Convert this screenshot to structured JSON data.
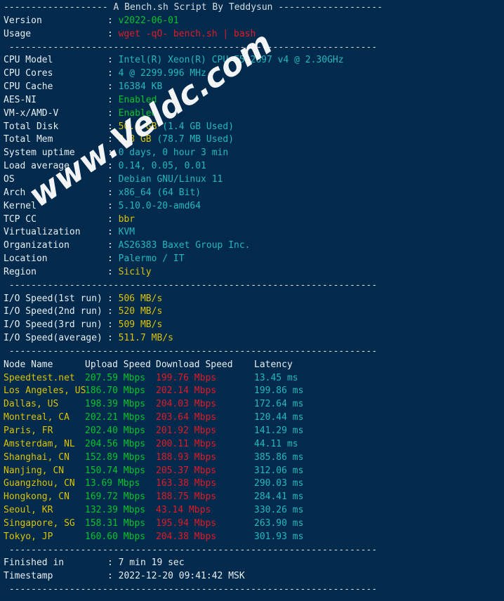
{
  "terminal": {
    "title_line": "------------------- A Bench.sh Script By Teddysun -------------------",
    "separator": " -------------------------------------------------------------------",
    "header": {
      "version_label": "Version",
      "version_value": "v2022-06-01",
      "usage_label": "Usage",
      "usage_value": "wget -qO- bench.sh | bash"
    },
    "sysinfo": [
      {
        "label": "CPU Model",
        "value": "Intel(R) Xeon(R) CPU E5-2697 v4 @ 2.30GHz",
        "color": "cyan"
      },
      {
        "label": "CPU Cores",
        "value": "4 @ 2299.996 MHz",
        "color": "cyan"
      },
      {
        "label": "CPU Cache",
        "value": "16384 KB",
        "color": "cyan"
      },
      {
        "label": "AES-NI",
        "value": "Enabled",
        "color": "green"
      },
      {
        "label": "VM-x/AMD-V",
        "value": "Enabled",
        "color": "green"
      },
      {
        "label": "Total Disk",
        "value": "50.1 GB",
        "value2": " (1.4 GB Used)",
        "color": "yellow",
        "color2": "cyan"
      },
      {
        "label": "Total Mem",
        "value": "3.8 GB",
        "value2": " (78.7 MB Used)",
        "color": "yellow",
        "color2": "cyan"
      },
      {
        "label": "System uptime",
        "value": "0 days, 0 hour 3 min",
        "color": "cyan"
      },
      {
        "label": "Load average",
        "value": "0.14, 0.05, 0.01",
        "color": "cyan"
      },
      {
        "label": "OS",
        "value": "Debian GNU/Linux 11",
        "color": "cyan"
      },
      {
        "label": "Arch",
        "value": "x86_64 (64 Bit)",
        "color": "cyan"
      },
      {
        "label": "Kernel",
        "value": "5.10.0-20-amd64",
        "color": "cyan"
      },
      {
        "label": "TCP CC",
        "value": "bbr",
        "color": "yellow"
      },
      {
        "label": "Virtualization",
        "value": "KVM",
        "color": "cyan"
      },
      {
        "label": "Organization",
        "value": "AS26383 Baxet Group Inc.",
        "color": "cyan"
      },
      {
        "label": "Location",
        "value": "Palermo / IT",
        "color": "cyan"
      },
      {
        "label": "Region",
        "value": "Sicily",
        "color": "yellow"
      }
    ],
    "io_speeds": [
      {
        "label": "I/O Speed(1st run)",
        "value": "506 MB/s"
      },
      {
        "label": "I/O Speed(2nd run)",
        "value": "520 MB/s"
      },
      {
        "label": "I/O Speed(3rd run)",
        "value": "509 MB/s"
      },
      {
        "label": "I/O Speed(average)",
        "value": "511.7 MB/s"
      }
    ],
    "speedtest": {
      "columns": [
        "Node Name",
        "Upload Speed",
        "Download Speed",
        "Latency"
      ],
      "rows": [
        {
          "node": "Speedtest.net",
          "upload": "207.59 Mbps",
          "download": "199.76 Mbps",
          "latency": "13.45 ms"
        },
        {
          "node": "Los Angeles, US",
          "upload": "186.70 Mbps",
          "download": "202.14 Mbps",
          "latency": "199.86 ms"
        },
        {
          "node": "Dallas, US",
          "upload": "198.39 Mbps",
          "download": "204.03 Mbps",
          "latency": "172.64 ms"
        },
        {
          "node": "Montreal, CA",
          "upload": "202.21 Mbps",
          "download": "203.64 Mbps",
          "latency": "120.44 ms"
        },
        {
          "node": "Paris, FR",
          "upload": "202.40 Mbps",
          "download": "201.92 Mbps",
          "latency": "141.29 ms"
        },
        {
          "node": "Amsterdam, NL",
          "upload": "204.56 Mbps",
          "download": "200.11 Mbps",
          "latency": "44.11 ms"
        },
        {
          "node": "Shanghai, CN",
          "upload": "152.89 Mbps",
          "download": "188.93 Mbps",
          "latency": "385.86 ms"
        },
        {
          "node": "Nanjing, CN",
          "upload": "150.74 Mbps",
          "download": "205.37 Mbps",
          "latency": "312.06 ms"
        },
        {
          "node": "Guangzhou, CN",
          "upload": "13.69 Mbps",
          "download": "163.38 Mbps",
          "latency": "290.03 ms"
        },
        {
          "node": "Hongkong, CN",
          "upload": "169.72 Mbps",
          "download": "188.75 Mbps",
          "latency": "284.41 ms"
        },
        {
          "node": "Seoul, KR",
          "upload": "132.39 Mbps",
          "download": "43.14 Mbps",
          "latency": "330.26 ms"
        },
        {
          "node": "Singapore, SG",
          "upload": "158.31 Mbps",
          "download": "195.94 Mbps",
          "latency": "263.90 ms"
        },
        {
          "node": "Tokyo, JP",
          "upload": "160.60 Mbps",
          "download": "204.38 Mbps",
          "latency": "301.93 ms"
        }
      ]
    },
    "footer": {
      "finished_label": "Finished in",
      "finished_value": "7 min 19 sec",
      "timestamp_label": "Timestamp",
      "timestamp_value": "2022-12-20 09:41:42 MSK"
    },
    "watermark": "www.Veldc.com"
  },
  "colors": {
    "background": "#012a4d",
    "white": "#e9eef2",
    "green": "#00c62a",
    "red": "#e21b26",
    "cyan": "#23b9bd",
    "yellow": "#ddc300"
  }
}
